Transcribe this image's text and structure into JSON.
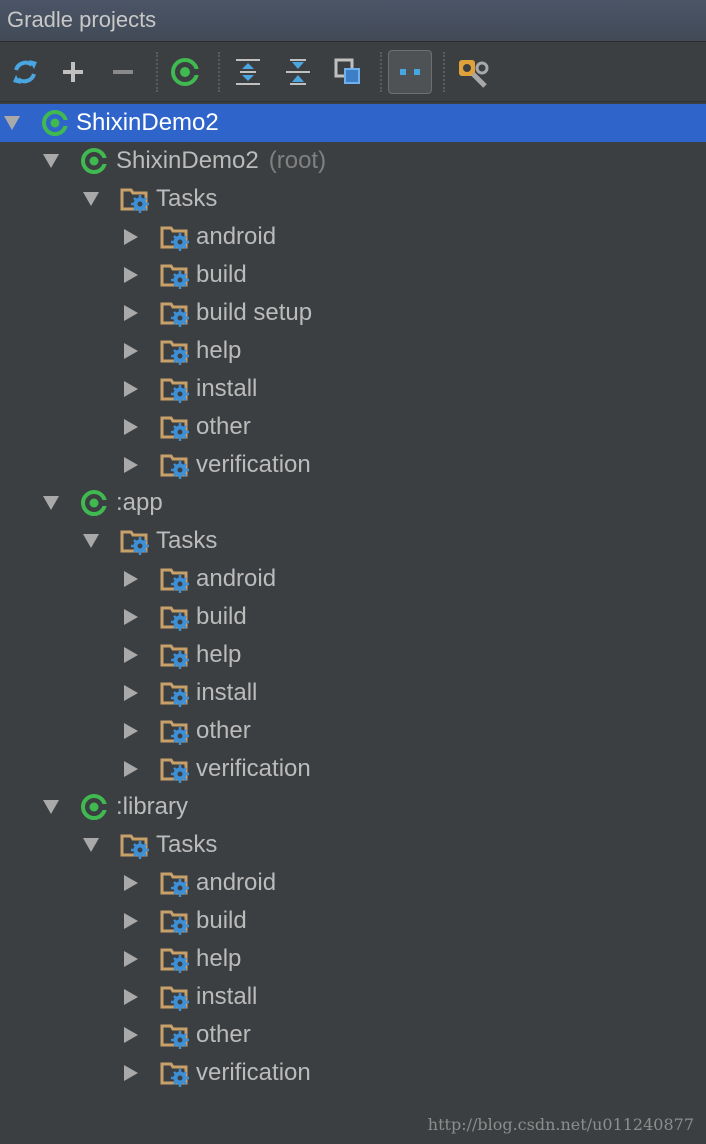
{
  "panel": {
    "title": "Gradle projects"
  },
  "toolbar": {
    "buttons": [
      {
        "icon": "refresh-icon"
      },
      {
        "icon": "plus-icon"
      },
      {
        "icon": "minus-icon"
      },
      {
        "icon": "gradle-execute-icon"
      },
      {
        "icon": "expand-all-icon"
      },
      {
        "icon": "collapse-all-icon"
      },
      {
        "icon": "group-modules-icon"
      },
      {
        "icon": "toggle-offline-icon",
        "active": true
      },
      {
        "icon": "gradle-settings-icon"
      }
    ]
  },
  "tree": {
    "root": {
      "label": "ShixinDemo2"
    },
    "modules": [
      {
        "label": "ShixinDemo2",
        "hint": "(root)",
        "tasks_label": "Tasks",
        "tasks": [
          "android",
          "build",
          "build setup",
          "help",
          "install",
          "other",
          "verification"
        ]
      },
      {
        "label": ":app",
        "hint": "",
        "tasks_label": "Tasks",
        "tasks": [
          "android",
          "build",
          "help",
          "install",
          "other",
          "verification"
        ]
      },
      {
        "label": ":library",
        "hint": "",
        "tasks_label": "Tasks",
        "tasks": [
          "android",
          "build",
          "help",
          "install",
          "other",
          "verification"
        ]
      }
    ]
  },
  "watermark": "http://blog.csdn.net/u011240877",
  "colors": {
    "background": "#3c3f41",
    "selection": "#2f65ca",
    "gradle_green": "#3fb950",
    "folder": "#c8a16a",
    "gear": "#3d8fd6"
  }
}
